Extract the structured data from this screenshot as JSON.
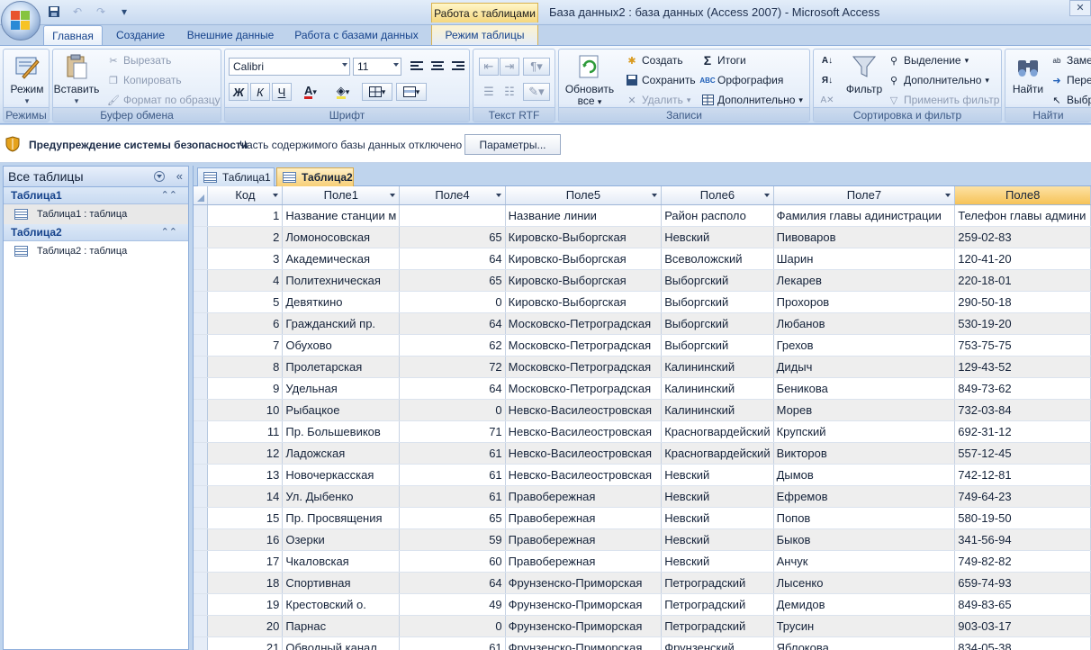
{
  "window": {
    "context_tab": "Работа с таблицами",
    "title": "База данных2 : база данных (Access 2007)  -  Microsoft Access",
    "close_glyph": "✕"
  },
  "ribbon_tabs": [
    {
      "label": "Главная",
      "active": true
    },
    {
      "label": "Создание"
    },
    {
      "label": "Внешние данные"
    },
    {
      "label": "Работа с базами данных"
    },
    {
      "label": "Режим таблицы"
    }
  ],
  "ribbon": {
    "groups": {
      "views": "Режимы",
      "clipboard": "Буфер обмена",
      "font": "Шрифт",
      "rtf": "Текст RTF",
      "records": "Записи",
      "sort_filter": "Сортировка и фильтр",
      "find": "Найти"
    },
    "view_btn": "Режим",
    "paste_btn": "Вставить",
    "cut": "Вырезать",
    "copy": "Копировать",
    "format_painter": "Формат по образцу",
    "font_name": "Calibri",
    "font_size": "11",
    "bold": "Ж",
    "italic": "К",
    "underline": "Ч",
    "refresh_btn_1": "Обновить",
    "refresh_btn_2": "все",
    "new": "Создать",
    "save": "Сохранить",
    "delete": "Удалить",
    "totals": "Итоги",
    "spelling": "Орфография",
    "more": "Дополнительно",
    "filter_btn": "Фильтр",
    "selection": "Выделение",
    "advanced": "Дополнительно",
    "apply_filter": "Применить фильтр",
    "find_btn": "Найти",
    "replace": "Заме",
    "goto": "Пере",
    "select": "Выбр"
  },
  "security_bar": {
    "title": "Предупреждение системы безопасности",
    "message": "Часть содержимого базы данных отключено",
    "button": "Параметры..."
  },
  "nav": {
    "header": "Все таблицы",
    "groups": [
      {
        "title": "Таблица1",
        "items": [
          "Таблица1 : таблица"
        ]
      },
      {
        "title": "Таблица2",
        "items": [
          "Таблица2 : таблица"
        ]
      }
    ]
  },
  "doc_tabs": [
    "Таблица1",
    "Таблица2"
  ],
  "table": {
    "columns": [
      "Код",
      "Поле1",
      "Поле4",
      "Поле5",
      "Поле6",
      "Поле7",
      "Поле8"
    ],
    "rows": [
      [
        "1",
        "Название станции м",
        "",
        "Название линии",
        "Район располо",
        "Фамилия главы адинистрации",
        "Телефон главы админи"
      ],
      [
        "2",
        "Ломоносовская",
        "65",
        "Кировско-Выборгская",
        "Невский",
        "Пивоваров",
        "259-02-83"
      ],
      [
        "3",
        "Академическая",
        "64",
        "Кировско-Выборгская",
        "Всеволожский",
        "Шарин",
        "120-41-20"
      ],
      [
        "4",
        "Политехническая",
        "65",
        "Кировско-Выборгская",
        "Выборгский",
        "Лекарев",
        "220-18-01"
      ],
      [
        "5",
        "Девяткино",
        "0",
        "Кировско-Выборгская",
        "Выборгский",
        "Прохоров",
        "290-50-18"
      ],
      [
        "6",
        "Гражданский пр.",
        "64",
        "Московско-Петроградская",
        "Выборгский",
        "Любанов",
        "530-19-20"
      ],
      [
        "7",
        "Обухово",
        "62",
        "Московско-Петроградская",
        "Выборгский",
        "Грехов",
        "753-75-75"
      ],
      [
        "8",
        "Пролетарская",
        "72",
        "Московско-Петроградская",
        "Калининский",
        "Дидыч",
        "129-43-52"
      ],
      [
        "9",
        "Удельная",
        "64",
        "Московско-Петроградская",
        "Калининский",
        "Беникова",
        "849-73-62"
      ],
      [
        "10",
        "Рыбацкое",
        "0",
        "Невско-Василеостровская",
        "Калининский",
        "Морев",
        "732-03-84"
      ],
      [
        "11",
        "Пр. Большевиков",
        "71",
        "Невско-Василеостровская",
        "Красногвардейский",
        "Крупский",
        "692-31-12"
      ],
      [
        "12",
        "Ладожская",
        "61",
        "Невско-Василеостровская",
        "Красногвардейский",
        "Викторов",
        "557-12-45"
      ],
      [
        "13",
        "Новочеркасская",
        "61",
        "Невско-Василеостровская",
        "Невский",
        "Дымов",
        "742-12-81"
      ],
      [
        "14",
        "Ул. Дыбенко",
        "61",
        "Правобережная",
        "Невский",
        "Ефремов",
        "749-64-23"
      ],
      [
        "15",
        "Пр. Просвящения",
        "65",
        "Правобережная",
        "Невский",
        "Попов",
        "580-19-50"
      ],
      [
        "16",
        "Озерки",
        "59",
        "Правобережная",
        "Невский",
        "Быков",
        "341-56-94"
      ],
      [
        "17",
        "Чкаловская",
        "60",
        "Правобережная",
        "Невский",
        "Анчук",
        "749-82-82"
      ],
      [
        "18",
        "Спортивная",
        "64",
        "Фрунзенско-Приморская",
        "Петроградский",
        "Лысенко",
        "659-74-93"
      ],
      [
        "19",
        "Крестовский о.",
        "49",
        "Фрунзенско-Приморская",
        "Петроградский",
        "Демидов",
        "849-83-65"
      ],
      [
        "20",
        "Парнас",
        "0",
        "Фрунзенско-Приморская",
        "Петроградский",
        "Трусин",
        "903-03-17"
      ],
      [
        "21",
        "Обводный канал",
        "61",
        "Фрунзенско-Приморская",
        "Фрунзенский",
        "Яблокова",
        "834-05-38"
      ]
    ]
  },
  "colors": {
    "accent": "#15428b",
    "active_header": "#f6c358",
    "alt_row": "#eeeeee"
  }
}
